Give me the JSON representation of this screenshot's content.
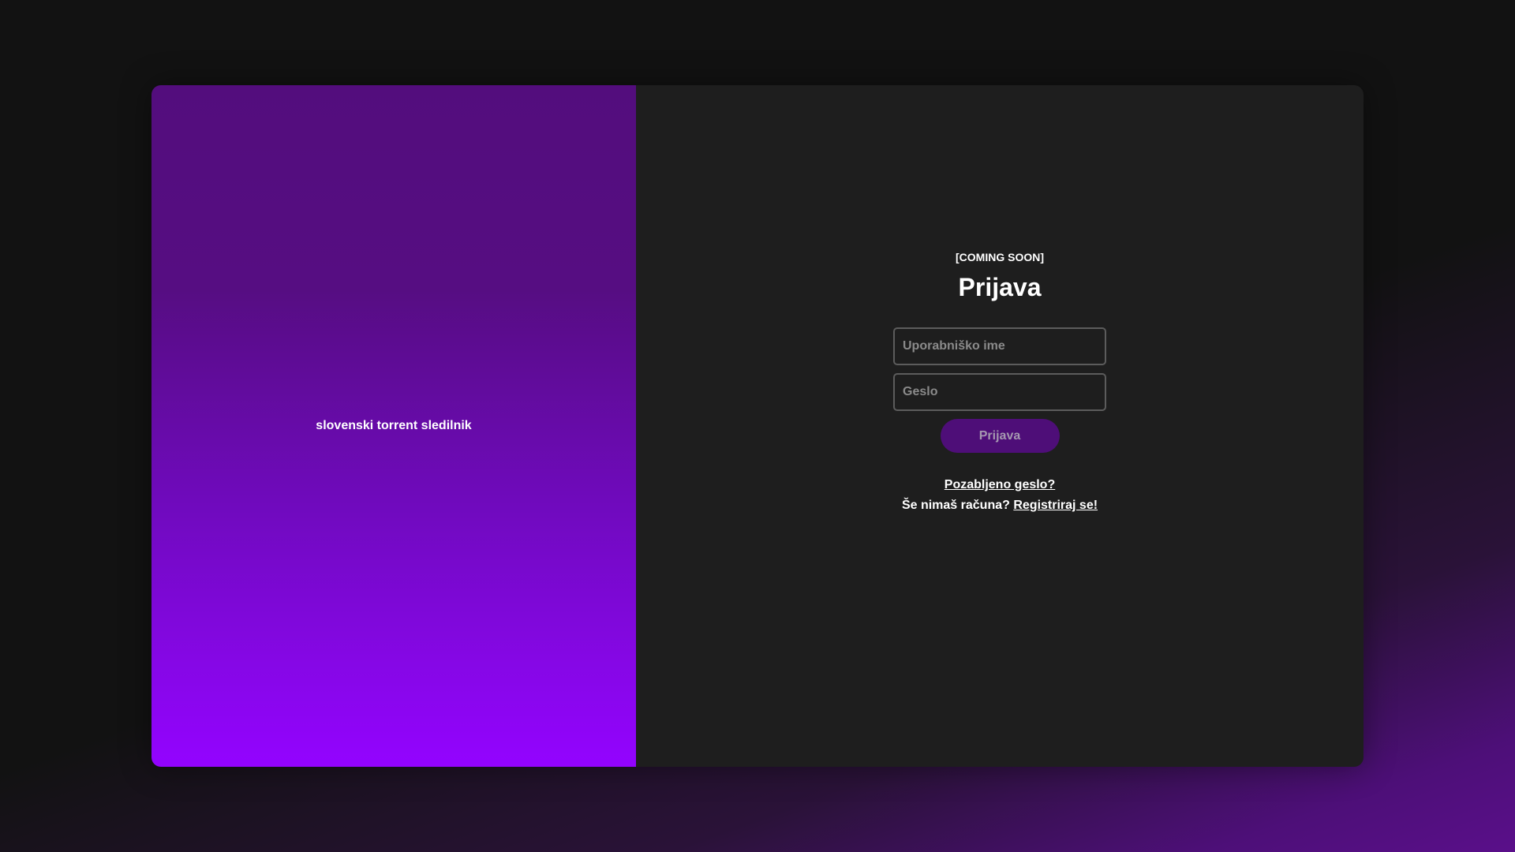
{
  "brand": {
    "tagline": "slovenski torrent sledilnik"
  },
  "login": {
    "notice": "[COMING SOON]",
    "title": "Prijava",
    "username_placeholder": "Uporabniško ime",
    "password_placeholder": "Geslo",
    "submit_label": "Prijava",
    "forgot_label": "Pozabljeno geslo?",
    "signup_prompt": "Še nimaš računa?",
    "signup_link": "Registriraj se!"
  },
  "colors": {
    "accent": "#9303ff",
    "panel": "#1e1e1e",
    "button": "#4e0e78"
  }
}
